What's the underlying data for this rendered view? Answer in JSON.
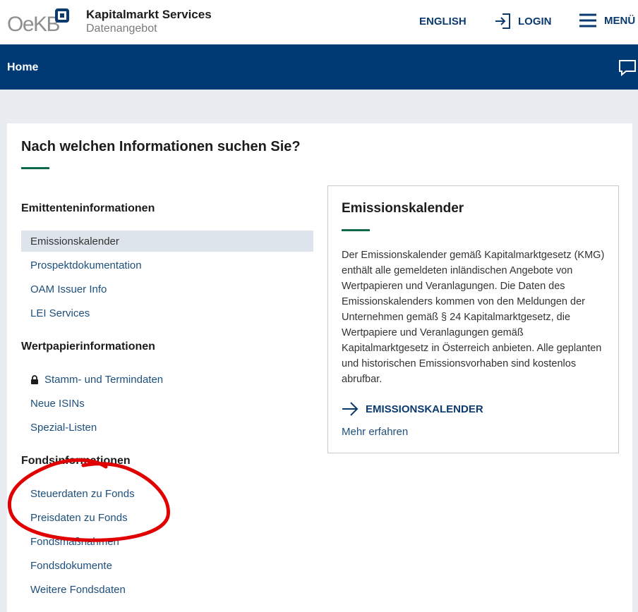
{
  "header": {
    "logo_text": "OeKB",
    "brand_title": "Kapitalmarkt Services",
    "brand_subtitle": "Datenangebot",
    "english": "ENGLISH",
    "login": "LOGIN",
    "menu": "MENÜ"
  },
  "navbar": {
    "home": "Home"
  },
  "main": {
    "heading": "Nach welchen Informationen suchen Sie?",
    "sections": [
      {
        "title": "Emittenteninformationen",
        "items": [
          "Emissionskalender",
          "Prospektdokumentation",
          "OAM Issuer Info",
          "LEI Services"
        ]
      },
      {
        "title": "Wertpapierinformationen",
        "items": [
          "Stamm- und Termindaten",
          "Neue ISINs",
          "Spezial-Listen"
        ]
      },
      {
        "title": "Fondsinformationen",
        "items": [
          "Steuerdaten zu Fonds",
          "Preisdaten zu Fonds",
          "Fondsmaßnahmen",
          "Fondsdokumente",
          "Weitere Fondsdaten"
        ]
      }
    ]
  },
  "detail": {
    "title": "Emissionskalender",
    "text": "Der Emissionskalender gemäß Kapitalmarktgesetz (KMG) enthält alle gemeldeten inländischen Angebote von Wertpapieren und Veranlagungen. Die Daten des Emissionskalenders kommen von den Meldungen der Unternehmen gemäß § 24 Kapitalmarktgesetz, die Wertpapiere und Veranlagungen gemäß Kapitalmarktgesetz in Österreich anbieten. Alle geplanten und historischen Emissionsvorhaben sind kostenlos abrufbar.",
    "cta": "EMISSIONSKALENDER",
    "more": "Mehr erfahren"
  },
  "colors": {
    "brand_blue": "#003a75",
    "accent_green": "#0c6a4a",
    "annotation_red": "#e00000"
  }
}
